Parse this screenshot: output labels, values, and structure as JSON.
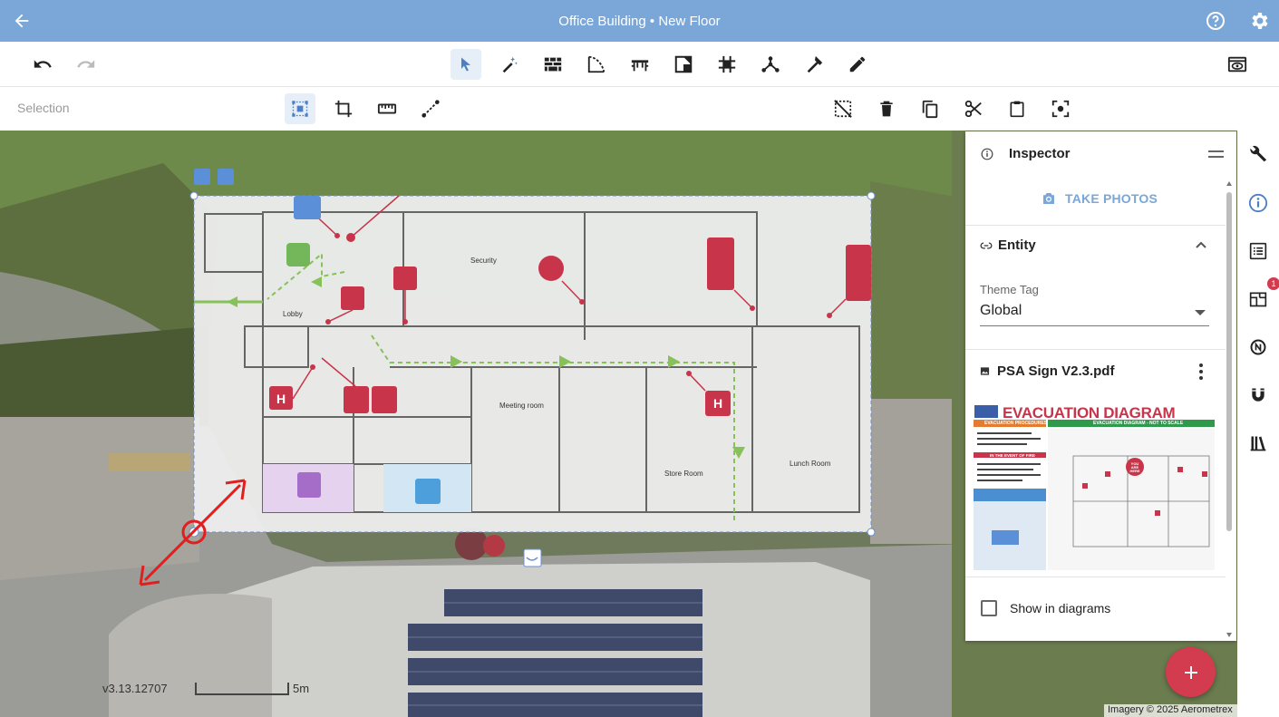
{
  "titlebar": {
    "title": "Office Building • New Floor"
  },
  "toolbar2": {
    "mode_label": "Selection"
  },
  "inspector": {
    "title": "Inspector",
    "take_photos_label": "TAKE PHOTOS",
    "entity_label": "Entity",
    "theme_tag_label": "Theme Tag",
    "theme_tag_value": "Global",
    "file_name": "PSA Sign V2.3.pdf",
    "show_in_diagrams_label": "Show in diagrams"
  },
  "thumbnail": {
    "title": "EVACUATION DIAGRAM",
    "subtitle": "EVACUATION DIAGRAM - NOT TO SCALE",
    "procedures": "EVACUATION PROCEDURES",
    "event_of_fire": "IN THE EVENT OF FIRE",
    "you_are_here": "YOU ARE HERE"
  },
  "floorplan": {
    "rooms": [
      "Security",
      "Lobby",
      "Meeting room",
      "Store Room",
      "Lunch Room"
    ]
  },
  "rail": {
    "notification_count": "1"
  },
  "map": {
    "version": "v3.13.12707",
    "scale_label": "5m",
    "attribution": "Imagery © 2025 Aerometrex"
  },
  "colors": {
    "header": "#7aa7d8",
    "accent": "#d33b4f",
    "active_tool": "#e6eef8"
  }
}
